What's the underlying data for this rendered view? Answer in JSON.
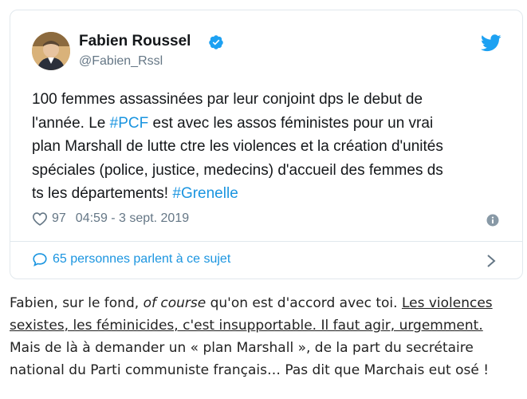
{
  "tweet": {
    "display_name": "Fabien Roussel",
    "handle": "@Fabien_Rssl",
    "text_lines": [
      [
        "100 femmes assassinées par leur conjoint dps le debut de",
        "",
        ""
      ],
      [
        "l'année. Le ",
        "#PCF",
        " est avec les assos féministes pour un vrai"
      ],
      [
        "plan Marshall de lutte ctre les violences et la création d'unités",
        "",
        ""
      ],
      [
        "spéciales (police, justice, medecins) d'accueil des femmes ds",
        "",
        ""
      ],
      [
        "ts les départements! ",
        "#Grenelle",
        ""
      ]
    ],
    "like_count": "97",
    "timestamp": "04:59 - 3 sept. 2019",
    "conversation_label": "65 personnes parlent à ce sujet",
    "colors": {
      "link": "#1b95e0",
      "verified": "#1da1f2",
      "bird": "#1da1f2",
      "secondary": "#657786"
    },
    "icons": [
      "verified-badge-icon",
      "twitter-bird-icon",
      "heart-icon",
      "info-icon",
      "speech-bubble-icon",
      "chevron-right-icon"
    ]
  },
  "commentary": {
    "line1_a": "Fabien, sur le fond, ",
    "line1_italic": "of course",
    "line1_b": " qu'on est d'accord avec toi. ",
    "line1_underlined": "Les violences",
    "line2_underlined": "sexistes, les féminicides, c'est insupportable. Il faut agir, urgemment.",
    "line3": "Mais de là à demander un « plan Marshall », de la part du secrétaire",
    "line4": "national du Parti communiste français… Pas dit que Marchais eut osé !"
  }
}
